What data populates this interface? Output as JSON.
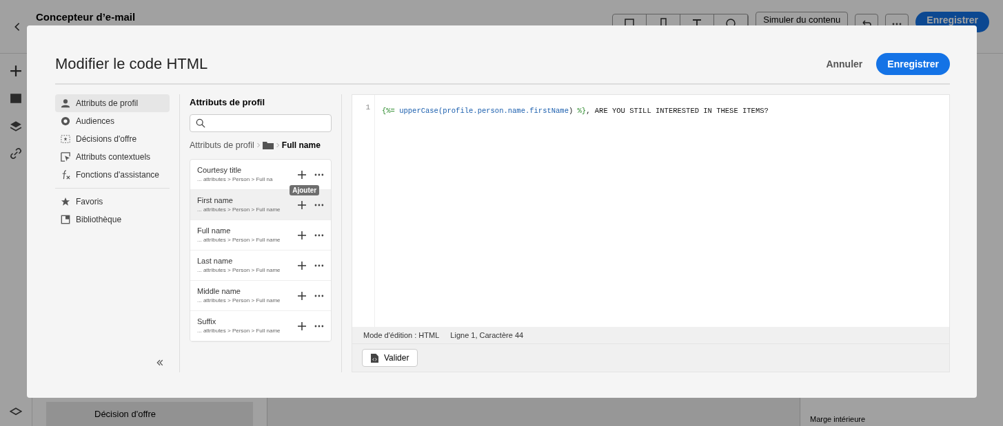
{
  "app": {
    "title": "Concepteur d’e-mail",
    "simulate_button": "Simuler du contenu",
    "save_button": "Enregistrer",
    "offer_item": "Décision d'offre",
    "padding_label": "Marge intérieure"
  },
  "dialog": {
    "title": "Modifier le code HTML",
    "cancel": "Annuler",
    "save": "Enregistrer",
    "nav": [
      {
        "label": "Attributs de profil",
        "kind": "person",
        "selected": true
      },
      {
        "label": "Audiences",
        "kind": "audience",
        "selected": false
      },
      {
        "label": "Décisions d'offre",
        "kind": "offer",
        "selected": false
      },
      {
        "label": "Attributs contextuels",
        "kind": "pointer",
        "selected": false
      },
      {
        "label": "Fonctions d'assistance",
        "kind": "fx",
        "selected": false
      }
    ],
    "nav_secondary": [
      {
        "label": "Favoris",
        "kind": "star",
        "selected": false
      },
      {
        "label": "Bibliothèque",
        "kind": "library",
        "selected": false
      }
    ],
    "browser": {
      "heading": "Attributs de profil",
      "breadcrumb_root": "Attributs de profil",
      "breadcrumb_current": "Full name",
      "items": [
        {
          "name": "Courtesy title",
          "path": "... attributes > Person > Full na",
          "highlighted": false
        },
        {
          "name": "First name",
          "path": "... attributes > Person > Full name",
          "highlighted": true,
          "tooltip": "Ajouter"
        },
        {
          "name": "Full name",
          "path": "... attributes > Person > Full name",
          "highlighted": false
        },
        {
          "name": "Last name",
          "path": "... attributes > Person > Full name",
          "highlighted": false
        },
        {
          "name": "Middle name",
          "path": "... attributes > Person > Full name",
          "highlighted": false
        },
        {
          "name": "Suffix",
          "path": "... attributes > Person > Full name",
          "highlighted": false
        }
      ]
    },
    "editor": {
      "line_number": "1",
      "tokens": [
        {
          "text": "{%=",
          "kind": "delim"
        },
        {
          "text": " upperCase(profile.person.name.firstName",
          "kind": "expr"
        },
        {
          "text": ")",
          "kind": "plain"
        },
        {
          "text": " %}",
          "kind": "delim"
        },
        {
          "text": ", ARE YOU STILL INTERESTED IN THESE ITEMS?",
          "kind": "plain"
        }
      ],
      "mode": "Mode d'édition : HTML",
      "position": "Ligne 1, Caractère 44",
      "validate": "Valider"
    }
  }
}
